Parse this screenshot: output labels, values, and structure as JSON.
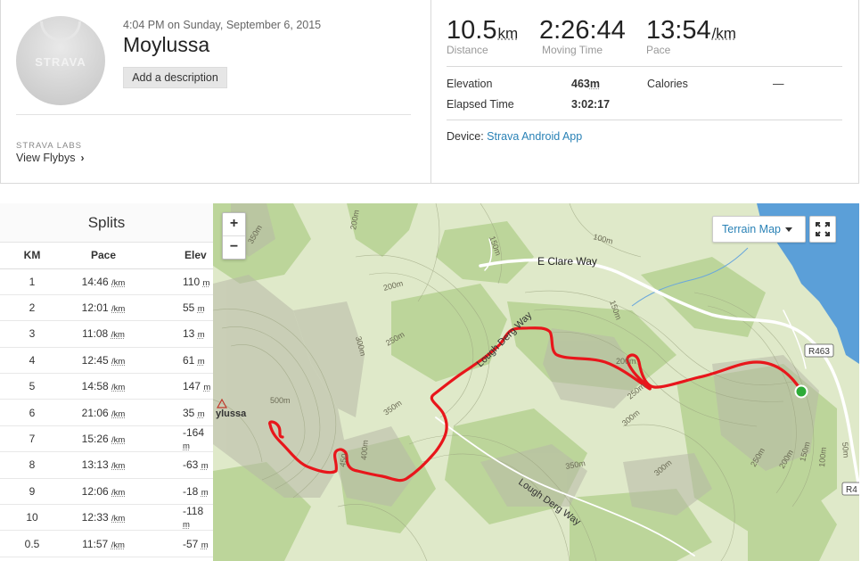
{
  "activity": {
    "datetime": "4:04 PM on Sunday, September 6, 2015",
    "title": "Moylussa",
    "add_description": "Add a description",
    "avatar_logo": "STRAVA"
  },
  "labs": {
    "caption": "STRAVA LABS",
    "flybys_link": "View Flybys",
    "chevron": "›"
  },
  "stats": {
    "distance": {
      "value": "10.5",
      "unit": "km",
      "label": "Distance"
    },
    "moving_time": {
      "value": "2:26:44",
      "label": "Moving Time"
    },
    "pace": {
      "value": "13:54",
      "unit": "/km",
      "label": "Pace"
    }
  },
  "more_stats": {
    "elevation_label": "Elevation",
    "elevation_value": "463",
    "elevation_unit": "m",
    "calories_label": "Calories",
    "calories_value": "—",
    "elapsed_label": "Elapsed Time",
    "elapsed_value": "3:02:17"
  },
  "device": {
    "label": "Device:",
    "value": "Strava Android App"
  },
  "splits": {
    "title": "Splits",
    "headers": {
      "km": "KM",
      "pace": "Pace",
      "elev": "Elev"
    },
    "pace_unit": "/km",
    "elev_unit": "m",
    "rows": [
      {
        "km": "1",
        "pace": "14:46",
        "elev": "110"
      },
      {
        "km": "2",
        "pace": "12:01",
        "elev": "55"
      },
      {
        "km": "3",
        "pace": "11:08",
        "elev": "13"
      },
      {
        "km": "4",
        "pace": "12:45",
        "elev": "61"
      },
      {
        "km": "5",
        "pace": "14:58",
        "elev": "147"
      },
      {
        "km": "6",
        "pace": "21:06",
        "elev": "35"
      },
      {
        "km": "7",
        "pace": "15:26",
        "elev": "-164"
      },
      {
        "km": "8",
        "pace": "13:13",
        "elev": "-63"
      },
      {
        "km": "9",
        "pace": "12:06",
        "elev": "-18"
      },
      {
        "km": "10",
        "pace": "12:33",
        "elev": "-118"
      },
      {
        "km": "0.5",
        "pace": "11:57",
        "elev": "-57"
      }
    ]
  },
  "map": {
    "zoom_in": "+",
    "zoom_out": "−",
    "type_selector": "Terrain Map",
    "colors": {
      "land": "#dfe9c9",
      "forest": "#bfd79c",
      "water": "#5b9fd8",
      "route": "#e8161b",
      "start_marker": "#2dab37",
      "relief": "#b9b9aa"
    },
    "labels": {
      "road_e_clare": "E Clare Way",
      "road_lough_derg_1": "Lough Derg Way",
      "road_lough_derg_2": "Lough Derg Way",
      "road_r463": "R463",
      "road_r4": "R4",
      "peak": "ylussa",
      "c_350_a": "350m",
      "c_200_a": "200m",
      "c_150_a": "150m",
      "c_100_a": "100m",
      "c_200_b": "200m",
      "c_300_a": "300m",
      "c_250_a": "250m",
      "c_150_b": "150m",
      "c_500": "500m",
      "c_350_b": "350m",
      "c_400": "400m",
      "c_450": "450",
      "c_200_c": "200m",
      "c_250_b": "250m",
      "c_300_b": "300m",
      "c_250_c": "250m",
      "c_200_d": "200m",
      "c_150_c": "150m",
      "c_100_b": "100m",
      "c_50": "50m",
      "c_350_c": "350m",
      "c_300_c": "300m"
    }
  }
}
